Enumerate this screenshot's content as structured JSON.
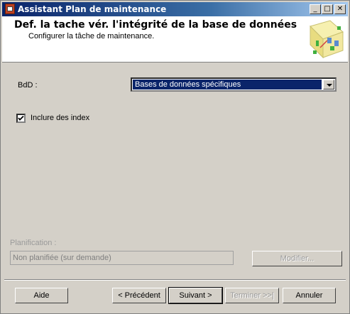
{
  "window": {
    "title": "Assistant Plan de maintenance",
    "controls": {
      "minimize": "_",
      "maximize": "□",
      "close": "✕"
    },
    "icon": "wizard-app-icon"
  },
  "header": {
    "heading": "Def. la tache vér. l'intégrité de la base de données",
    "subheading": "Configurer la tâche de maintenance.",
    "art_icon": "wizard-banner-graphic"
  },
  "form": {
    "db_label": "BdD :",
    "db_value": "Bases de données spécifiques",
    "include_index_label": "Inclure des index",
    "include_index_checked": true,
    "schedule_label": "Planification :",
    "schedule_value": "Non planifiée (sur demande)",
    "modify_button": "Modifier..."
  },
  "buttons": {
    "help": "Aide",
    "previous": "< Précédent",
    "next": "Suivant >",
    "finish": "Terminer >>|",
    "cancel": "Annuler"
  },
  "colors": {
    "titlebar": "#0a246a",
    "selection": "#0a246a",
    "face": "#d4d0c8"
  }
}
